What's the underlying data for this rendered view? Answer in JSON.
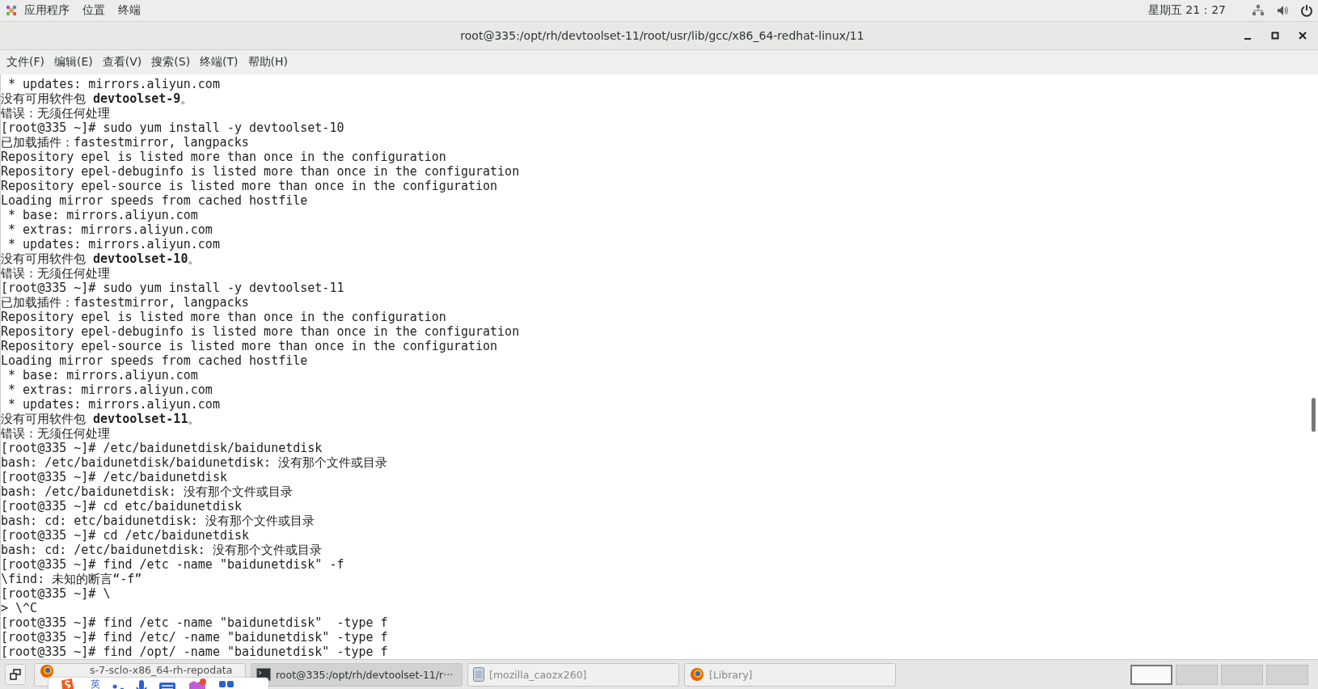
{
  "top_bar": {
    "menus": [
      "应用程序",
      "位置",
      "终端"
    ],
    "clock": "星期五 21：27"
  },
  "window": {
    "title": "root@335:/opt/rh/devtoolset-11/root/usr/lib/gcc/x86_64-redhat-linux/11"
  },
  "menu_bar": [
    "文件(F)",
    "编辑(E)",
    "查看(V)",
    "搜索(S)",
    "终端(T)",
    "帮助(H)"
  ],
  "terminal": {
    "lines": [
      " * updates: mirrors.aliyun.com",
      "没有可用软件包 **devtoolset-9**。",
      "错误：无须任何处理",
      "[root@335 ~]# sudo yum install -y devtoolset-10",
      "已加载插件：fastestmirror, langpacks",
      "Repository epel is listed more than once in the configuration",
      "Repository epel-debuginfo is listed more than once in the configuration",
      "Repository epel-source is listed more than once in the configuration",
      "Loading mirror speeds from cached hostfile",
      " * base: mirrors.aliyun.com",
      " * extras: mirrors.aliyun.com",
      " * updates: mirrors.aliyun.com",
      "没有可用软件包 **devtoolset-10**。",
      "错误：无须任何处理",
      "[root@335 ~]# sudo yum install -y devtoolset-11",
      "已加载插件：fastestmirror, langpacks",
      "Repository epel is listed more than once in the configuration",
      "Repository epel-debuginfo is listed more than once in the configuration",
      "Repository epel-source is listed more than once in the configuration",
      "Loading mirror speeds from cached hostfile",
      " * base: mirrors.aliyun.com",
      " * extras: mirrors.aliyun.com",
      " * updates: mirrors.aliyun.com",
      "没有可用软件包 **devtoolset-11**。",
      "错误：无须任何处理",
      "[root@335 ~]# /etc/baidunetdisk/baidunetdisk",
      "bash: /etc/baidunetdisk/baidunetdisk: 没有那个文件或目录",
      "[root@335 ~]# /etc/baidunetdisk",
      "bash: /etc/baidunetdisk: 没有那个文件或目录",
      "[root@335 ~]# cd etc/baidunetdisk",
      "bash: cd: etc/baidunetdisk: 没有那个文件或目录",
      "[root@335 ~]# cd /etc/baidunetdisk",
      "bash: cd: /etc/baidunetdisk: 没有那个文件或目录",
      "[root@335 ~]# find /etc -name \"baidunetdisk\" -f",
      "\\find: 未知的断言“-f”",
      "[root@335 ~]# \\",
      "> \\^C",
      "[root@335 ~]# find /etc -name \"baidunetdisk\"  -type f",
      "[root@335 ~]# find /etc/ -name \"baidunetdisk\" -type f",
      "[root@335 ~]# find /opt/ -name \"baidunetdisk\" -type f"
    ]
  },
  "taskbar": {
    "tasks": [
      {
        "kind": "browser",
        "label": "s-7-sclo-x86_64-rh-repodata",
        "selected": false
      },
      {
        "kind": "terminal",
        "label": "root@335:/opt/rh/devtoolset-11/r···",
        "selected": true
      },
      {
        "kind": "document",
        "label": "[mozilla_caozx260]",
        "selected": false
      },
      {
        "kind": "browser",
        "label": "[Library]",
        "selected": false
      }
    ],
    "workspaces": [
      {
        "selected": true
      },
      {
        "selected": false
      },
      {
        "selected": false
      },
      {
        "selected": false
      }
    ]
  },
  "ime_toolbar": {
    "mode": "英"
  }
}
